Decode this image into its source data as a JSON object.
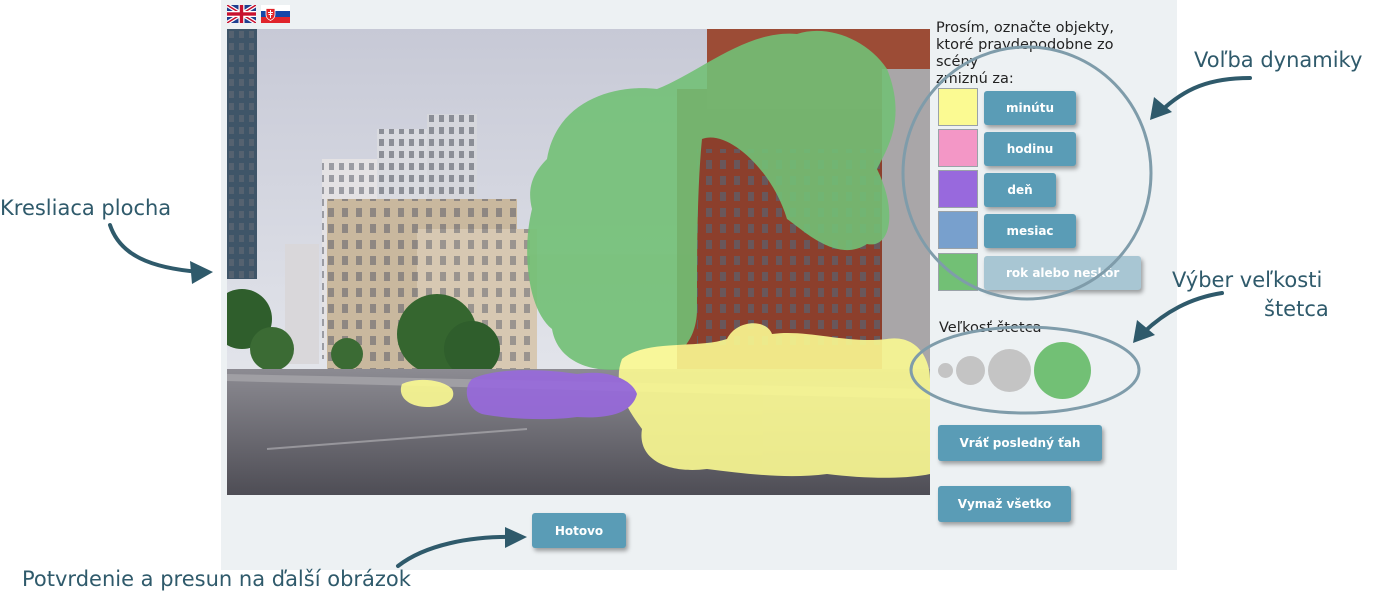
{
  "colors": {
    "minute": "#fbfa92",
    "hour": "#f397c6",
    "day": "#9869dd",
    "month": "#78a0cd",
    "year": "#72c075",
    "button": "#5a9cb6",
    "annotation": "#2f5a6b"
  },
  "flags": [
    {
      "icon": "uk-flag-icon"
    },
    {
      "icon": "slovak-flag-icon"
    }
  ],
  "prompt": "Prosím, označte objekty,\nktoré pravdepodobne zo scény\nzmiznú za:",
  "dynamics": [
    {
      "label": "minútu",
      "color": "#fbfa92"
    },
    {
      "label": "hodinu",
      "color": "#f397c6"
    },
    {
      "label": "deň",
      "color": "#9869dd"
    },
    {
      "label": "mesiac",
      "color": "#78a0cd"
    },
    {
      "label": "rok alebo neskôr",
      "color": "#72c075"
    }
  ],
  "brush": {
    "label": "Veľkosť štetca",
    "sizes": [
      "xs",
      "s",
      "m",
      "l"
    ],
    "selected": "l"
  },
  "actions": {
    "undo": "Vráť posledný ťah",
    "clear": "Vymaž všetko",
    "done": "Hotovo"
  },
  "annotations": {
    "canvas": "Kresliaca plocha",
    "dynamics": "Voľba dynamiky",
    "brush_line1": "Výber veľkosti",
    "brush_line2": "štetca",
    "confirm": "Potvrdenie a presun na ďalší obrázok"
  }
}
